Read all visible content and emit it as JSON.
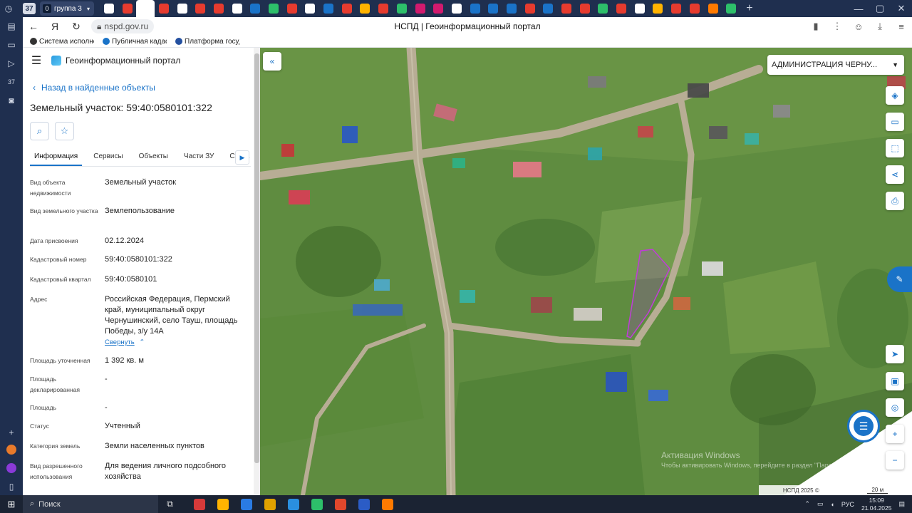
{
  "browser": {
    "tab_count": "37",
    "tab_group_count": "0",
    "tab_group_label": "группа 3",
    "url": "nspd.gov.ru",
    "page_title": "НСПД | Геоинформационный портал",
    "sidebar_badge": "37",
    "bookmarks": [
      {
        "label": "Система исполне"
      },
      {
        "label": "Публичная кадас"
      },
      {
        "label": "Платформа госуд"
      }
    ],
    "tab_icon_colors": [
      "#ffffff",
      "#e63b2e",
      "#ffffff",
      "#e63b2e",
      "#ffffff",
      "#e63b2e",
      "#e63b2e",
      "#ffffff",
      "#1a73c8",
      "#2dbf6a",
      "#e63b2e",
      "#ffffff",
      "#1a73c8",
      "#e63b2e",
      "#ffb300",
      "#e63b2e",
      "#2dbf6a",
      "#d21a6e",
      "#d21a6e",
      "#ffffff",
      "#1a73c8",
      "#1a73c8",
      "#1a73c8",
      "#e63b2e",
      "#1a73c8",
      "#e63b2e",
      "#e63b2e",
      "#2dbf6a",
      "#e63b2e",
      "#ffffff",
      "#ffb300",
      "#e63b2e",
      "#e63b2e",
      "#ff7a00",
      "#2dbf6a"
    ]
  },
  "portal": {
    "header_title": "Геоинформационный портал",
    "back_label": "Назад в найденные объекты",
    "object_title": "Земельный участок: 59:40:0580101:322",
    "tabs": [
      {
        "label": "Информация",
        "active": true
      },
      {
        "label": "Сервисы",
        "active": false
      },
      {
        "label": "Объекты",
        "active": false
      },
      {
        "label": "Части ЗУ",
        "active": false
      },
      {
        "label": "Соста",
        "active": false
      }
    ],
    "properties": [
      {
        "key": "Вид объекта недвижимости",
        "value": "Земельный участок"
      },
      {
        "key": "Вид земельного участка",
        "value": "Землепользование"
      },
      {
        "key": "Дата присвоения",
        "value": "02.12.2024"
      },
      {
        "key": "Кадастровый номер",
        "value": "59:40:0580101:322"
      },
      {
        "key": "Кадастровый квартал",
        "value": "59:40:0580101"
      },
      {
        "key": "Адрес",
        "value": "Российская Федерация, Пермский край, муниципальный округ Чернушинский, село Тауш, площадь Победы, з/у 14А"
      },
      {
        "key": "Площадь уточненная",
        "value": "1 392 кв. м"
      },
      {
        "key": "Площадь декларированная",
        "value": "-"
      },
      {
        "key": "Площадь",
        "value": "-"
      },
      {
        "key": "Статус",
        "value": "Учтенный"
      },
      {
        "key": "Категория земель",
        "value": "Земли населенных пунктов"
      },
      {
        "key": "Вид разрешенного использования",
        "value": "Для ведения личного подсобного хозяйства"
      }
    ],
    "collapse_label": "Свернуть"
  },
  "map": {
    "region_select": "АДМИНИСТРАЦИЯ ЧЕРНУ...",
    "watermark_title": "Активация Windows",
    "watermark_text": "Чтобы активировать Windows, перейдите в раздел \"Параметры\".",
    "footer_copyright": "НСПД 2025 ©",
    "footer_scale": "20 м",
    "parcel_color": "#c03cd8"
  },
  "taskbar": {
    "search_label": "Поиск",
    "language": "РУС",
    "time": "15:09",
    "date": "21.04.2025",
    "app_colors": [
      "#d63a3a",
      "#ffb300",
      "#2a7be4",
      "#e0a100",
      "#2a8fe0",
      "#2dbf6a",
      "#e0472c",
      "#2b5cc6",
      "#ff7a00"
    ]
  }
}
